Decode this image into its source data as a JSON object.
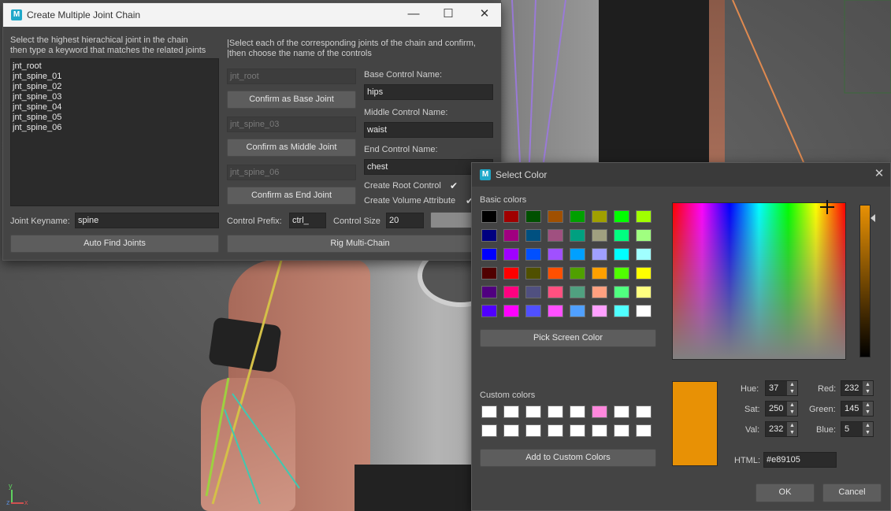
{
  "chain_window": {
    "title": "Create Multiple Joint Chain",
    "controls": {
      "minimize": "—",
      "maximize": "☐",
      "close": "✕"
    },
    "left_instruction_1": "Select the highest hierachical joint in the chain",
    "left_instruction_2": "then type a keyword that matches the related joints",
    "right_instruction_1": "|Select each of the corresponding joints of the chain and confirm,",
    "right_instruction_2": "|then choose the name of the controls",
    "joints": [
      "jnt_root",
      "jnt_spine_01",
      "jnt_spine_02",
      "jnt_spine_03",
      "jnt_spine_04",
      "jnt_spine_05",
      "jnt_spine_06"
    ],
    "base_joint_field": "jnt_root",
    "confirm_base_label": "Confirm as Base Joint",
    "middle_joint_field": "jnt_spine_03",
    "confirm_middle_label": "Confirm as Middle Joint",
    "end_joint_field": "jnt_spine_06",
    "confirm_end_label": "Confirm as End Joint",
    "base_control_label": "Base Control Name:",
    "base_control_value": "hips",
    "middle_control_label": "Middle Control Name:",
    "middle_control_value": "waist",
    "end_control_label": "End Control Name:",
    "end_control_value": "chest",
    "create_root_label": "Create Root Control",
    "create_root_checked": "✔",
    "create_volume_label": "Create Volume Attribute",
    "create_volume_checked": "✔",
    "keyname_label": "Joint Keyname:",
    "keyname_value": "spine",
    "prefix_label": "Control Prefix:",
    "prefix_value": "ctrl_",
    "size_label": "Control Size",
    "size_value": "20",
    "control_color": "#8a8a8a",
    "auto_find_label": "Auto Find Joints",
    "rig_label": "Rig Multi-Chain"
  },
  "color_dialog": {
    "title": "Select Color",
    "close": "✕",
    "basic_colors_label": "Basic colors",
    "basic_colors": [
      [
        "#000000",
        "#a00000",
        "#005000",
        "#a05000",
        "#00a000",
        "#a0a000",
        "#00ff00",
        "#a0ff00"
      ],
      [
        "#000080",
        "#a00080",
        "#005080",
        "#a05080",
        "#00a080",
        "#a0a080",
        "#00ff80",
        "#a0ff80"
      ],
      [
        "#0000ff",
        "#a000ff",
        "#0050ff",
        "#a050ff",
        "#00a0ff",
        "#a0a0ff",
        "#00ffff",
        "#a0ffff"
      ],
      [
        "#500000",
        "#ff0000",
        "#505000",
        "#ff5000",
        "#50a000",
        "#ffa000",
        "#50ff00",
        "#ffff00"
      ],
      [
        "#500080",
        "#ff0080",
        "#505080",
        "#ff5080",
        "#50a080",
        "#ffa080",
        "#50ff80",
        "#ffff80"
      ],
      [
        "#5000ff",
        "#ff00ff",
        "#5050ff",
        "#ff50ff",
        "#50a0ff",
        "#ffa0ff",
        "#50ffff",
        "#ffffff"
      ]
    ],
    "pick_screen_label": "Pick Screen Color",
    "custom_colors_label": "Custom colors",
    "custom_colors": [
      [
        "#ffffff",
        "#ffffff",
        "#ffffff",
        "#ffffff",
        "#ffffff",
        "#ff88dd",
        "#ffffff",
        "#ffffff"
      ],
      [
        "#ffffff",
        "#ffffff",
        "#ffffff",
        "#ffffff",
        "#ffffff",
        "#ffffff",
        "#ffffff",
        "#ffffff"
      ]
    ],
    "add_custom_label": "Add to Custom Colors",
    "current_color": "#e89105",
    "hue_label": "Hue:",
    "hue_value": "37",
    "sat_label": "Sat:",
    "sat_value": "250",
    "val_label": "Val:",
    "val_value": "232",
    "red_label": "Red:",
    "red_value": "232",
    "green_label": "Green:",
    "green_value": "145",
    "blue_label": "Blue:",
    "blue_value": "5",
    "html_label": "HTML:",
    "html_value": "#e89105",
    "ok_label": "OK",
    "cancel_label": "Cancel"
  },
  "viewport": {
    "axis_x": "x",
    "axis_y": "y",
    "axis_z": "z"
  }
}
